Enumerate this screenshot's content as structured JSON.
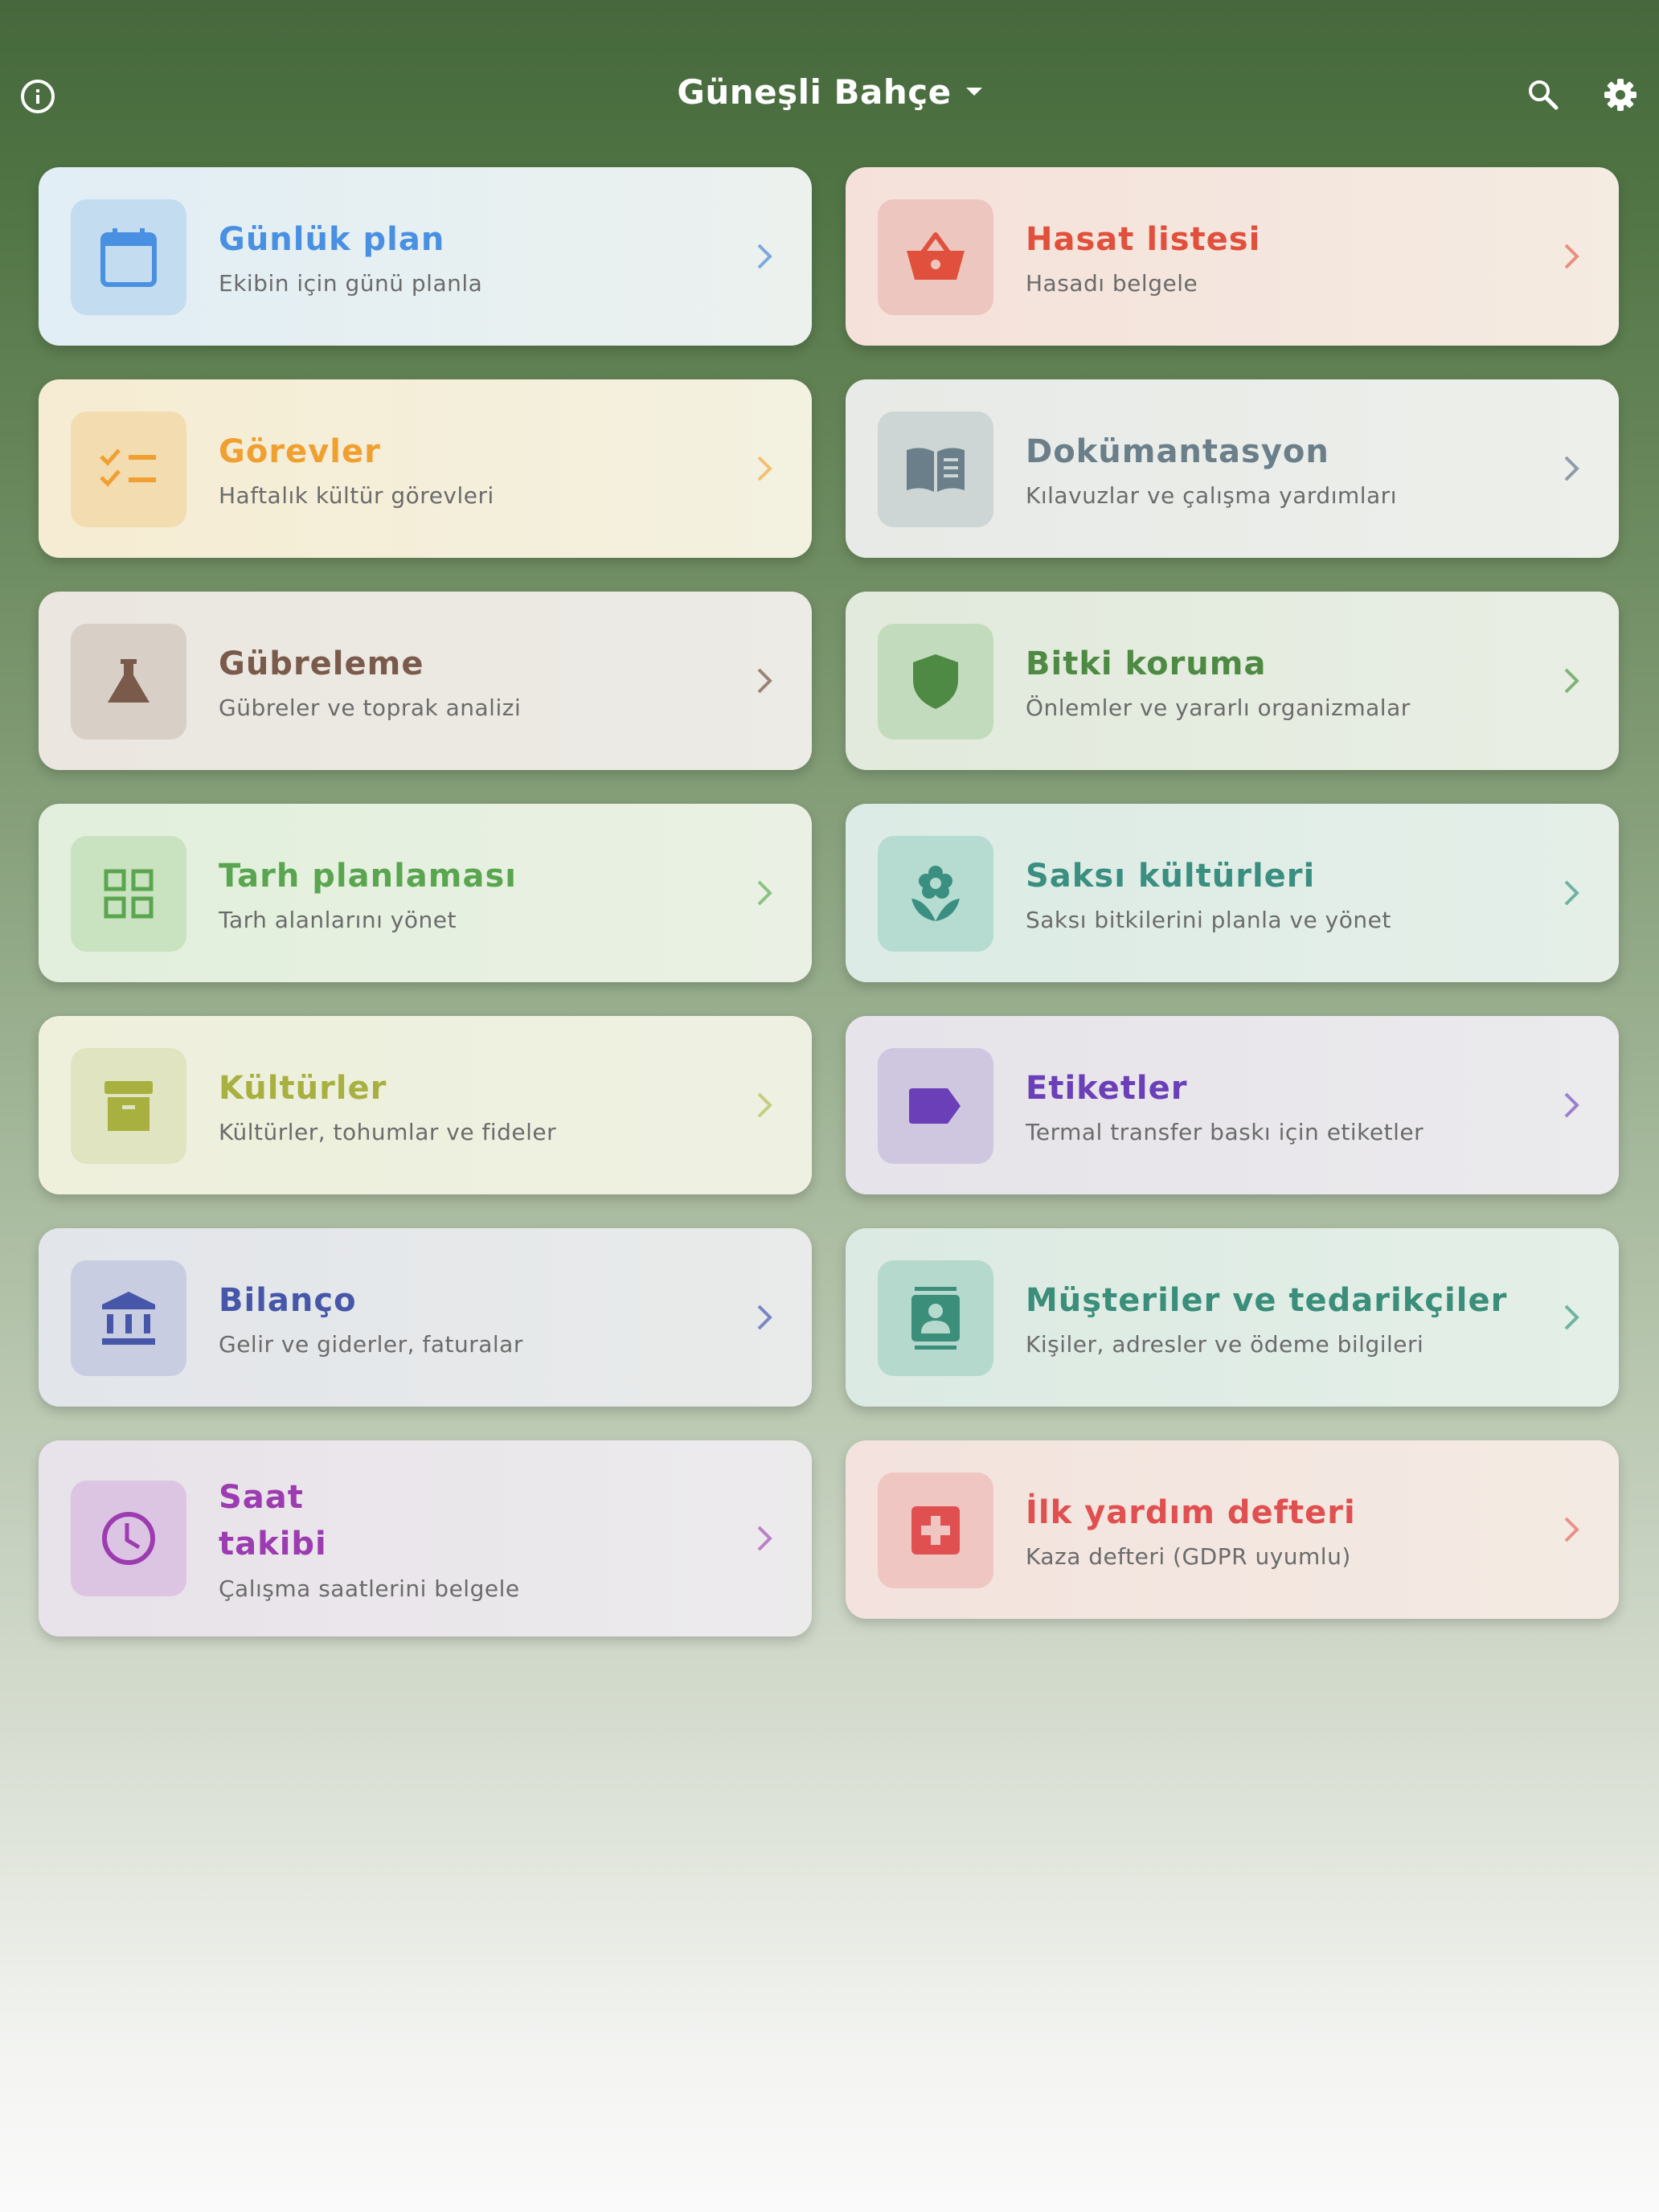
{
  "header": {
    "title": "Güneşli Bahçe"
  },
  "cards": [
    {
      "title": "Günlük plan",
      "subtitle": "Ekibin için günü planla",
      "icon": "calendar-icon",
      "color": "#4a90e2"
    },
    {
      "title": "Hasat listesi",
      "subtitle": "Hasadı belgele",
      "icon": "basket-icon",
      "color": "#e0503c"
    },
    {
      "title": "Görevler",
      "subtitle": "Haftalık kültür görevleri",
      "icon": "checklist-icon",
      "color": "#f0a030"
    },
    {
      "title": "Dokümantasyon",
      "subtitle": "Kılavuzlar ve çalışma yardımları",
      "icon": "book-icon",
      "color": "#6b7f8a"
    },
    {
      "title": "Gübreleme",
      "subtitle": "Gübreler ve toprak analizi",
      "icon": "flask-icon",
      "color": "#7a5a4a"
    },
    {
      "title": "Bitki koruma",
      "subtitle": "Önlemler ve yararlı organizmalar",
      "icon": "shield-icon",
      "color": "#4e8a44"
    },
    {
      "title": "Tarh planlaması",
      "subtitle": "Tarh alanlarını yönet",
      "icon": "grid-icon",
      "color": "#5aa650"
    },
    {
      "title": "Saksı kültürleri",
      "subtitle": "Saksı bitkilerini planla ve yönet",
      "icon": "flower-icon",
      "color": "#3b8f80"
    },
    {
      "title": "Kültürler",
      "subtitle": "Kültürler, tohumlar ve fideler",
      "icon": "archive-icon",
      "color": "#a8b040"
    },
    {
      "title": "Etiketler",
      "subtitle": "Termal transfer baskı için etiketler",
      "icon": "label-icon",
      "color": "#6a3fb8"
    },
    {
      "title": "Bilanço",
      "subtitle": "Gelir ve giderler, faturalar",
      "icon": "bank-icon",
      "color": "#4656a8"
    },
    {
      "title": "Müşteriler ve tedarikçiler",
      "subtitle": "Kişiler, adresler ve ödeme bilgileri",
      "icon": "contact-icon",
      "color": "#3a8e7a"
    },
    {
      "title": "Saat takibi",
      "subtitle": "Çalışma saatlerini belgele",
      "icon": "clock-icon",
      "color": "#9c3cb0"
    },
    {
      "title": "İlk yardım defteri",
      "subtitle": "Kaza defteri (GDPR uyumlu)",
      "icon": "first-aid-icon",
      "color": "#e05050"
    }
  ]
}
